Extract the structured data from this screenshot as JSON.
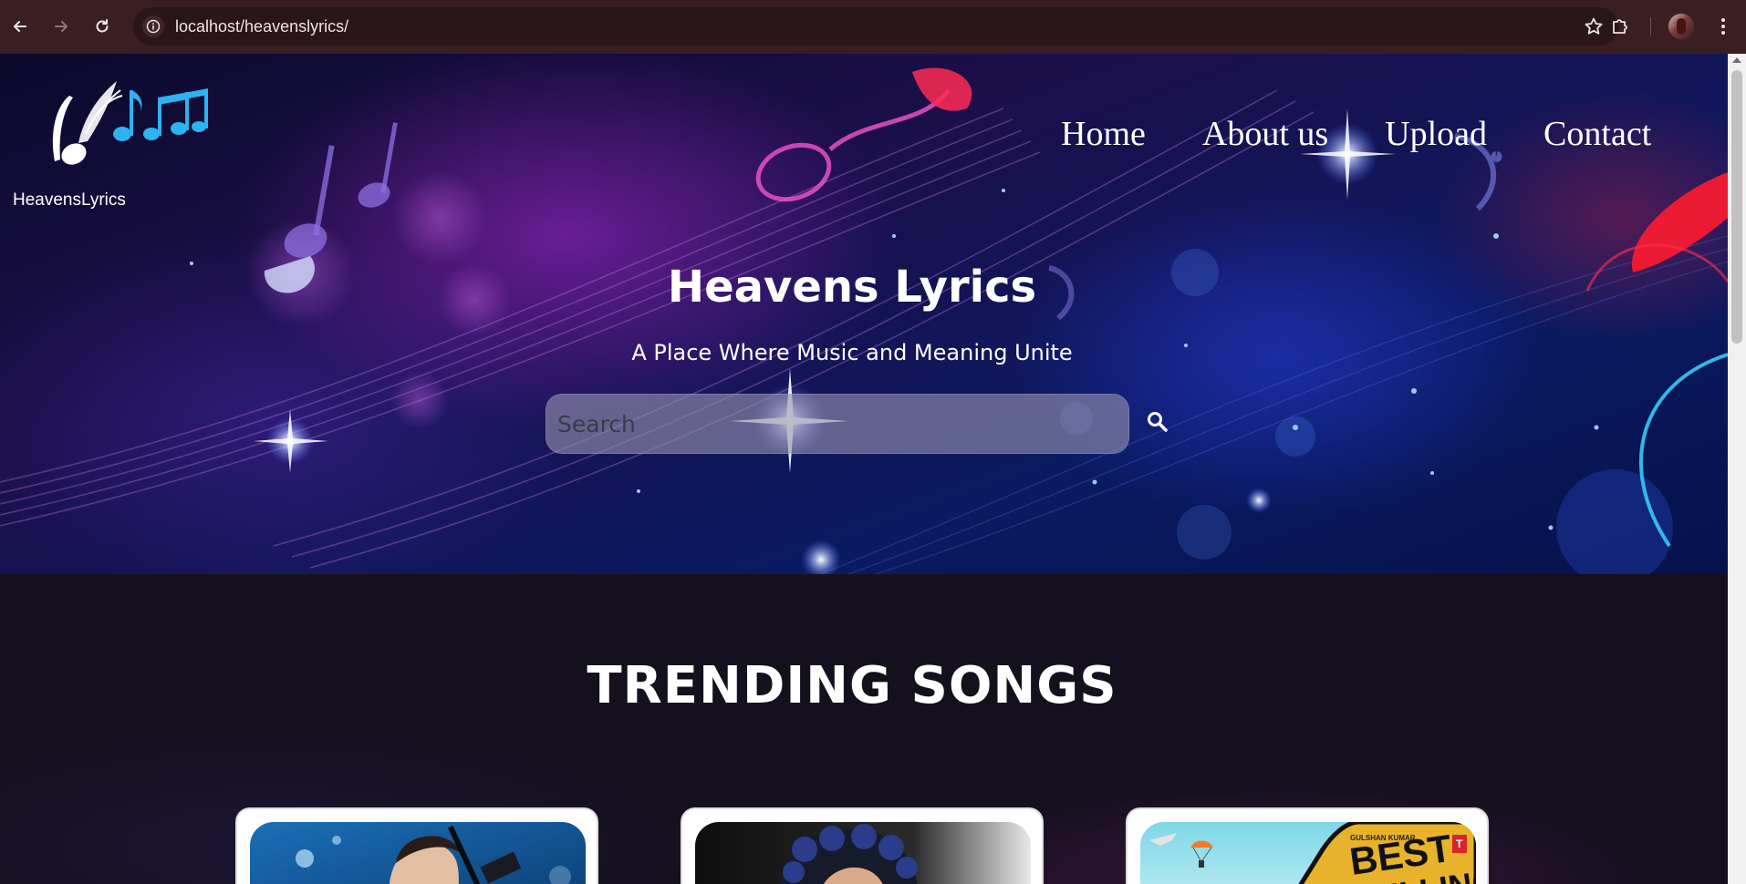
{
  "browser": {
    "url": "localhost/heavenslyrics/",
    "back_icon": "arrow-left-icon",
    "forward_icon": "arrow-right-icon",
    "reload_icon": "reload-icon",
    "info_icon": "info-icon",
    "bookmark_icon": "star-icon",
    "extensions_icon": "puzzle-icon",
    "menu_icon": "kebab-menu-icon"
  },
  "site": {
    "logo_text": "HeavensLyrics",
    "nav": [
      "Home",
      "About us",
      "Upload",
      "Contact"
    ]
  },
  "hero": {
    "title": "Heavens Lyrics",
    "subtitle": "A Place Where Music and Meaning Unite",
    "search_placeholder": "Search",
    "search_icon": "search-icon"
  },
  "trending": {
    "title": "TRENDING SONGS",
    "cards": [
      {
        "image": "singer-with-guitar-photo"
      },
      {
        "image": "curly-haired-singer-photo"
      },
      {
        "image": "best-travelling-songs-poster",
        "poster_brand": "GULSHAN KUMAR",
        "poster_text": "BEST TRAVELLING SONGS"
      }
    ]
  },
  "colors": {
    "chrome_bg": "#3a1f22",
    "page_bg": "#15101d",
    "accent_purple": "#aa28d2",
    "accent_blue": "#2840dc"
  }
}
